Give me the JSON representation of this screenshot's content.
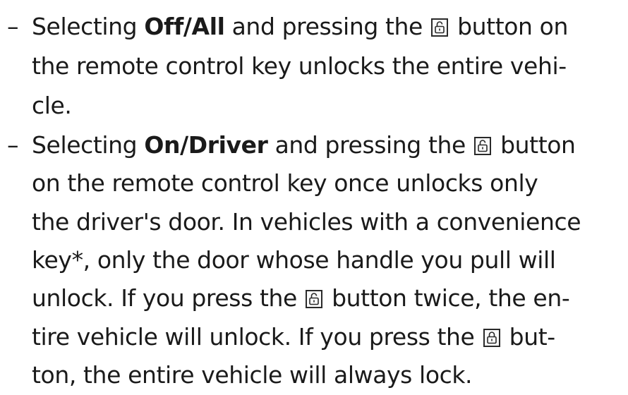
{
  "items": [
    {
      "dash": "–",
      "lines": [
        {
          "segments": [
            {
              "t": "text",
              "v": "Selecting "
            },
            {
              "t": "bold",
              "v": "Off/All"
            },
            {
              "t": "text",
              "v": " and pressing the "
            },
            {
              "t": "icon",
              "name": "unlock-key-icon"
            },
            {
              "t": "text",
              "v": " button on"
            }
          ]
        },
        {
          "segments": [
            {
              "t": "text",
              "v": "the remote control key unlocks the entire vehi-"
            }
          ]
        },
        {
          "segments": [
            {
              "t": "text",
              "v": "cle."
            }
          ]
        }
      ]
    },
    {
      "dash": "–",
      "lines": [
        {
          "segments": [
            {
              "t": "text",
              "v": "Selecting "
            },
            {
              "t": "bold",
              "v": "On/Driver"
            },
            {
              "t": "text",
              "v": " and pressing the "
            },
            {
              "t": "icon",
              "name": "unlock-key-icon"
            },
            {
              "t": "text",
              "v": " button"
            }
          ]
        },
        {
          "segments": [
            {
              "t": "text",
              "v": "on the remote control key once unlocks only"
            }
          ]
        },
        {
          "segments": [
            {
              "t": "text",
              "v": "the driver's door. In vehicles with a convenience"
            }
          ]
        },
        {
          "segments": [
            {
              "t": "text",
              "v": "key*, only the door whose handle you pull will"
            }
          ]
        },
        {
          "segments": [
            {
              "t": "text",
              "v": "unlock. If you press the "
            },
            {
              "t": "icon",
              "name": "unlock-key-icon"
            },
            {
              "t": "text",
              "v": " button twice, the en-"
            }
          ]
        },
        {
          "segments": [
            {
              "t": "text",
              "v": "tire vehicle will unlock. If you press the "
            },
            {
              "t": "icon",
              "name": "lock-key-icon"
            },
            {
              "t": "text",
              "v": " but-"
            }
          ]
        },
        {
          "segments": [
            {
              "t": "text",
              "v": "ton, the entire vehicle will always lock."
            }
          ]
        }
      ]
    }
  ]
}
